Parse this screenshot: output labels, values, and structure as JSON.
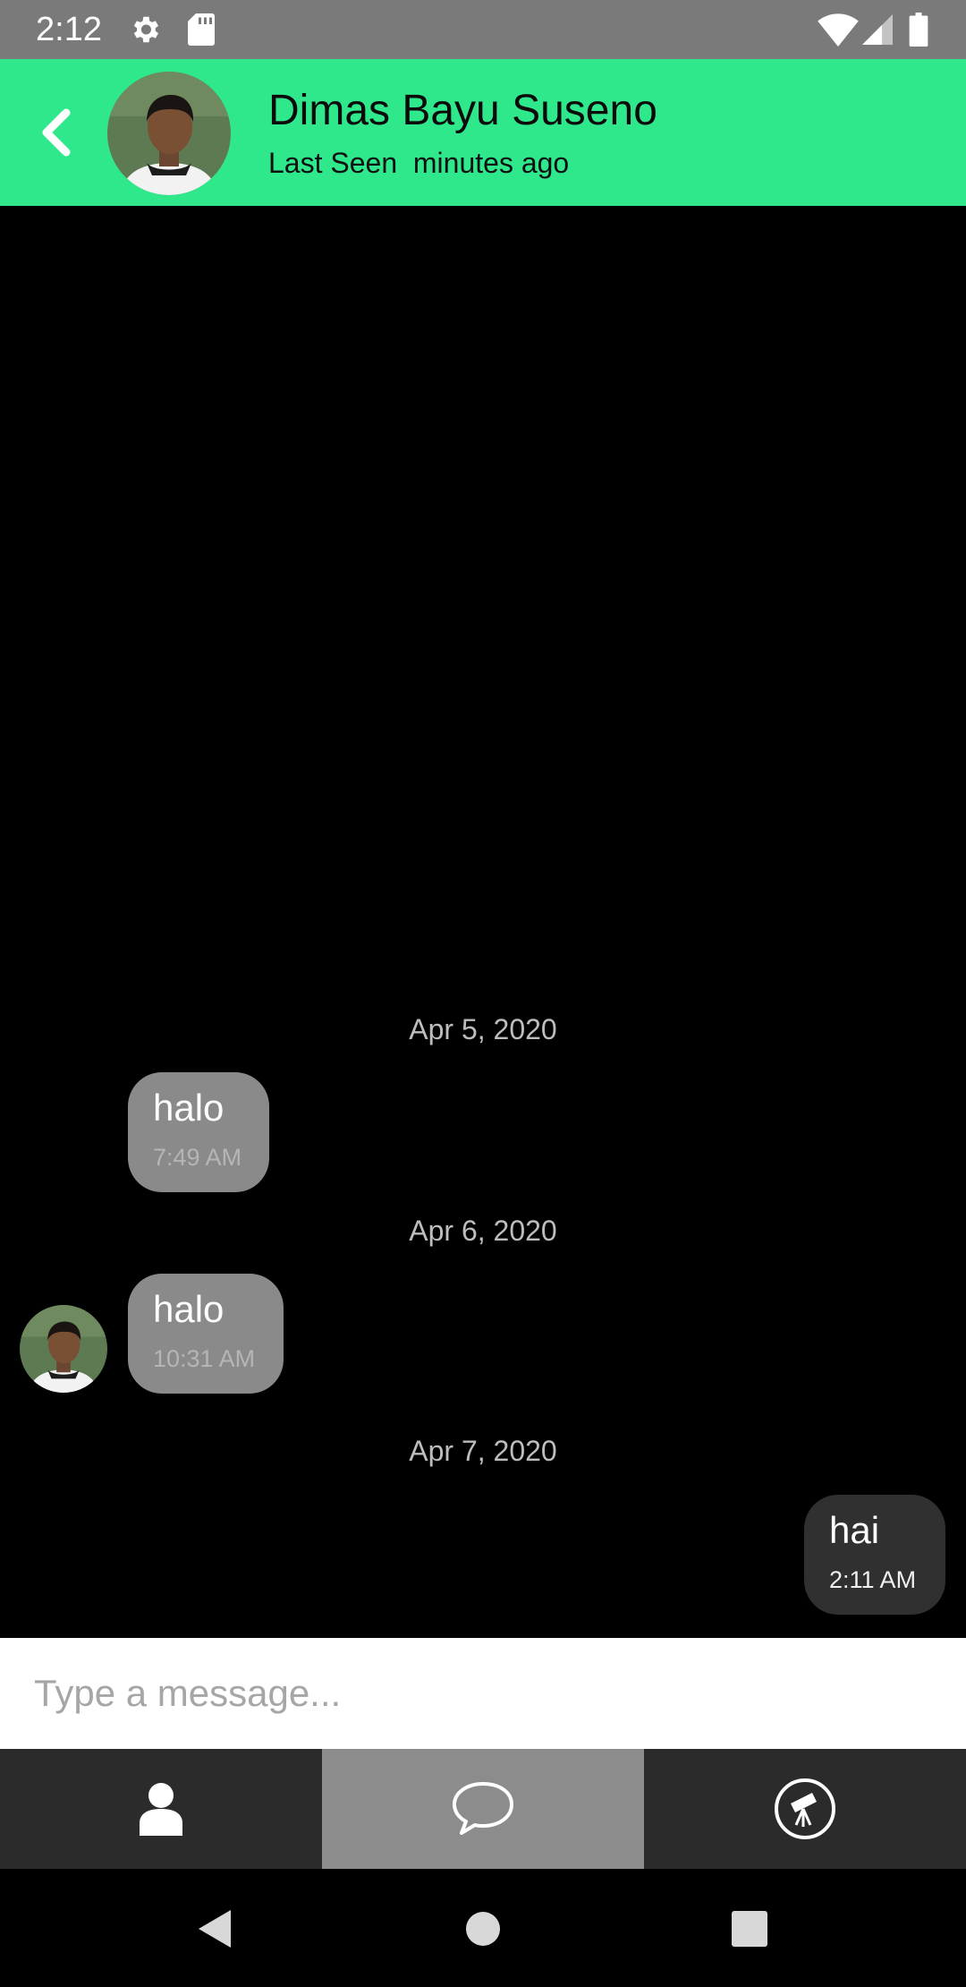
{
  "status_bar": {
    "time": "2:12",
    "icons": [
      "gear-icon",
      "sd-card-icon",
      "wifi-icon",
      "cell-signal-icon",
      "battery-icon"
    ]
  },
  "header": {
    "contact_name": "Dimas Bayu Suseno",
    "last_seen": "Last Seen  minutes ago",
    "background_color": "#2fe88c"
  },
  "messages": {
    "date_1": "Apr 5, 2020",
    "msg_1": {
      "text": "halo",
      "time": "7:49 AM",
      "direction": "incoming"
    },
    "date_2": "Apr 6, 2020",
    "msg_2": {
      "text": "halo",
      "time": "10:31 AM",
      "direction": "incoming"
    },
    "date_3": "Apr 7, 2020",
    "msg_3": {
      "text": "hai",
      "time": "2:11 AM",
      "direction": "outgoing"
    }
  },
  "composer": {
    "placeholder": "Type a message..."
  },
  "bottom_nav": {
    "tabs": [
      {
        "icon": "person-icon",
        "active": false
      },
      {
        "icon": "chat-bubble-icon",
        "active": true
      },
      {
        "icon": "telescope-icon",
        "active": false
      }
    ]
  },
  "system_nav": {
    "buttons": [
      "back-triangle-icon",
      "home-circle-icon",
      "recents-square-icon"
    ]
  }
}
